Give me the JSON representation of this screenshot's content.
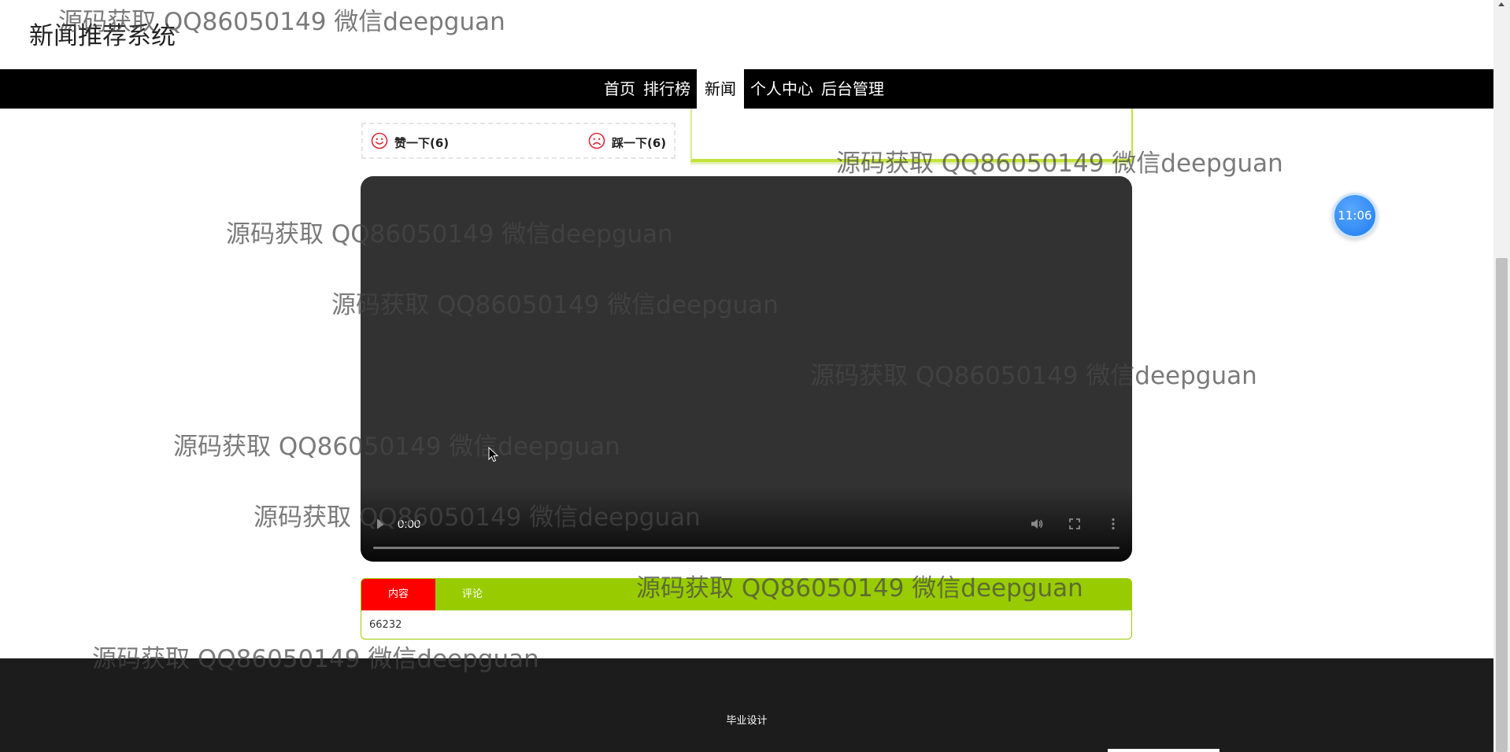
{
  "header": {
    "site_title": "新闻推荐系统"
  },
  "nav": {
    "items": [
      {
        "label": "首页",
        "active": false
      },
      {
        "label": "排行榜",
        "active": false
      },
      {
        "label": "新闻",
        "active": true
      },
      {
        "label": "个人中心",
        "active": false
      },
      {
        "label": "后台管理",
        "active": false
      }
    ]
  },
  "votes": {
    "like_label": "赞一下(6)",
    "dislike_label": "踩一下(6)",
    "like_icon": "smile-icon",
    "dislike_icon": "frown-icon",
    "icon_color": "#e0283a"
  },
  "video": {
    "time": "0:00",
    "progress": 0,
    "controls": [
      "play-icon",
      "volume-icon",
      "fullscreen-icon",
      "more-icon"
    ]
  },
  "tabs": {
    "items": [
      {
        "label": "内容",
        "active": true
      },
      {
        "label": "评论",
        "active": false
      }
    ],
    "content": "66232",
    "active_color": "#ff0000",
    "bar_color": "#99cc00"
  },
  "footer": {
    "text": "毕业设计"
  },
  "clock": {
    "time": "11:06"
  },
  "watermark": {
    "text": "源码获取 QQ86050149 微信deepguan"
  }
}
